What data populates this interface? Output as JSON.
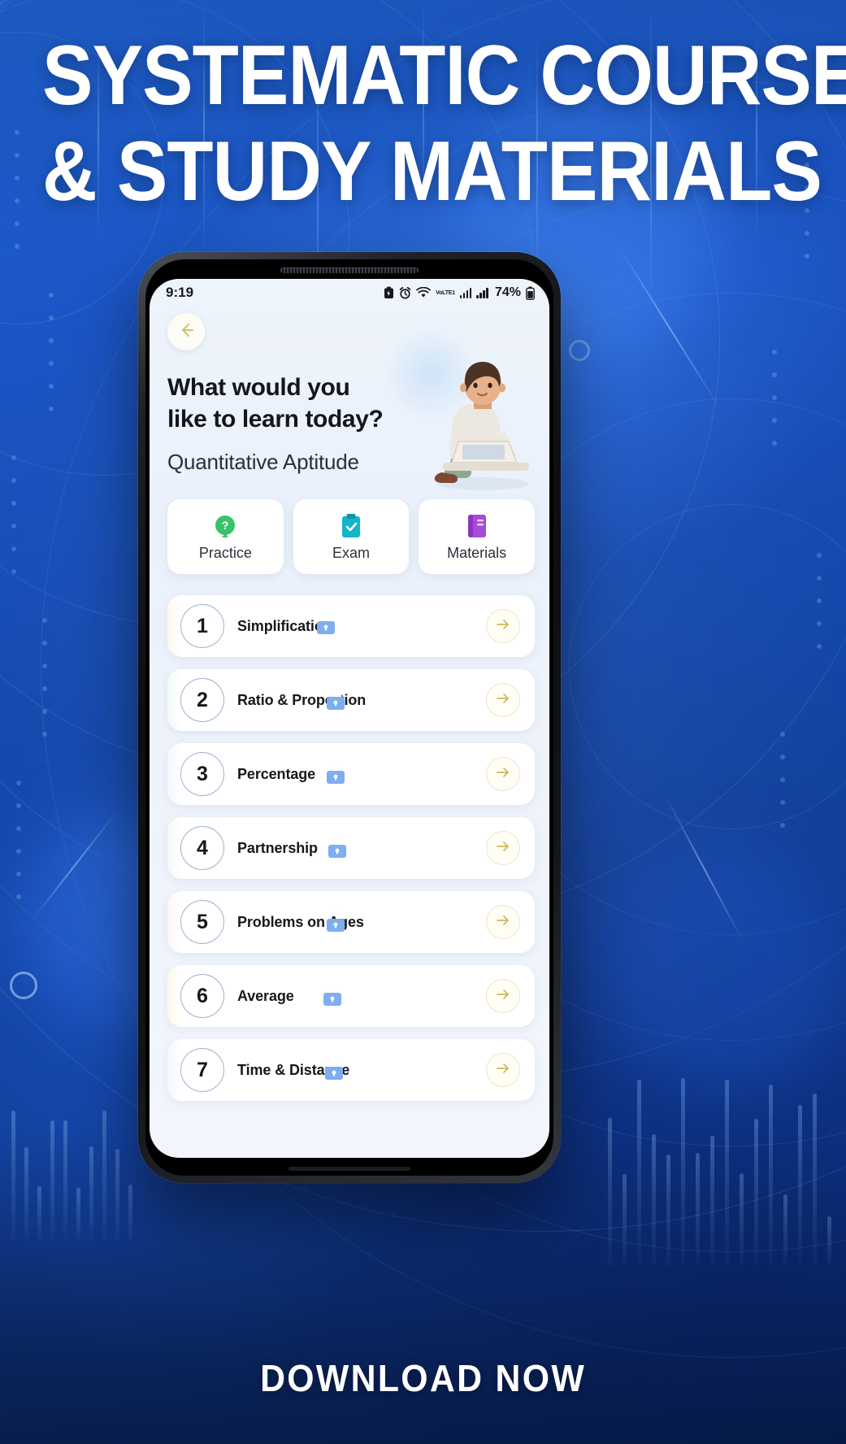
{
  "banner": {
    "headline_line1": "SYSTEMATIC COURSES",
    "headline_line2": "& STUDY MATERIALS",
    "cta": "DOWNLOAD NOW",
    "bg_color": "#1548ac",
    "accent_color": "#3c82f5"
  },
  "phone": {
    "statusbar": {
      "time": "9:19",
      "battery_percent": "74%",
      "network_label": "VoLTE1",
      "icons": [
        "battery-saver-icon",
        "alarm-icon",
        "wifi-icon",
        "volte-icon",
        "signal-bars-icon",
        "signal-bars-icon",
        "battery-icon"
      ]
    },
    "app": {
      "back_icon": "arrow-left-icon",
      "heading_line1": "What would you",
      "heading_line2": "like to learn today?",
      "subject": "Quantitative Aptitude",
      "illustration": "student-with-laptop-illustration",
      "chips": [
        {
          "label": "Practice",
          "icon": "question-badge-icon",
          "color": "#35c46a"
        },
        {
          "label": "Exam",
          "icon": "clipboard-check-icon",
          "color": "#13b5c9"
        },
        {
          "label": "Materials",
          "icon": "book-icon",
          "color": "#a64bd6"
        }
      ],
      "topics": [
        {
          "number": "1",
          "name": "Simplification",
          "locked": true,
          "tint": "a"
        },
        {
          "number": "2",
          "name": "Ratio & Proportion",
          "locked": true,
          "tint": "b"
        },
        {
          "number": "3",
          "name": "Percentage",
          "locked": true,
          "tint": "c"
        },
        {
          "number": "4",
          "name": "Partnership",
          "locked": true,
          "tint": "b"
        },
        {
          "number": "5",
          "name": "Problems on Ages",
          "locked": true,
          "tint": "d"
        },
        {
          "number": "6",
          "name": "Average",
          "locked": true,
          "tint": "a"
        },
        {
          "number": "7",
          "name": "Time & Distance",
          "locked": true,
          "tint": "c"
        }
      ],
      "row_action_icon": "arrow-right-icon",
      "lock_icon": "lock-icon"
    }
  }
}
